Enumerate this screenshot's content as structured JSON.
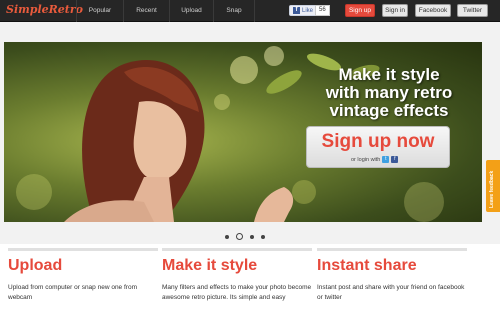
{
  "brand": {
    "logo_text": "SimpleRetro"
  },
  "nav": {
    "items": [
      "Popular",
      "Recent",
      "Upload",
      "Snap"
    ]
  },
  "social": {
    "like_label": "Like",
    "like_count": "56"
  },
  "header_buttons": {
    "signup": "Sign up",
    "signin": "Sign in",
    "facebook": "Facebook",
    "twitter": "Twitter"
  },
  "hero": {
    "headline_line1": "Make it style",
    "headline_line2": "with many retro",
    "headline_line3": "vintage effects",
    "signup_label": "Sign up now",
    "login_label": "or login with"
  },
  "carousel": {
    "slide_count": 4,
    "active_index": 1
  },
  "feedback_label": "Leave feedback",
  "features": [
    {
      "title": "Upload",
      "desc": "Upload from computer or snap new one from webcam"
    },
    {
      "title": "Make it style",
      "desc": "Many filters and effects to make your photo become awesome retro picture. Its simple and easy"
    },
    {
      "title": "Instant share",
      "desc": "Instant post and share with your friend on facebook or twitter"
    }
  ],
  "colors": {
    "accent": "#e64a3c",
    "topbar": "#262626",
    "feedback": "#f3a017"
  }
}
